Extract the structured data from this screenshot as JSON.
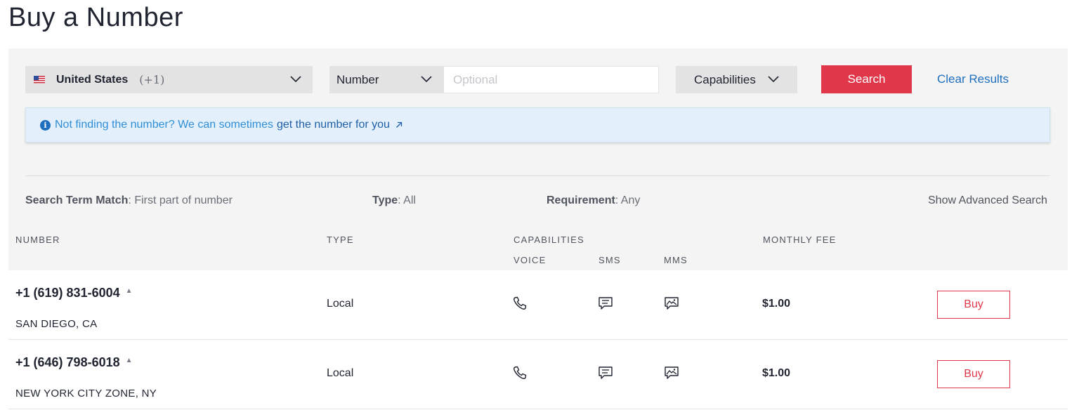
{
  "page": {
    "title": "Buy a Number"
  },
  "search": {
    "country": {
      "name": "United States",
      "code": "(+1)",
      "flag_icon": "us-flag-icon"
    },
    "number_type": {
      "selected": "Number"
    },
    "number_input": {
      "value": "",
      "placeholder": "Optional"
    },
    "capabilities": {
      "label": "Capabilities"
    },
    "search_label": "Search",
    "clear_label": "Clear Results"
  },
  "info_banner": {
    "text": "Not finding the number? We can sometimes",
    "link_text": "get the number for you"
  },
  "filters": {
    "match": {
      "label": "Search Term Match",
      "value": ": First part of number"
    },
    "type": {
      "label": "Type",
      "value": ": All"
    },
    "requirement": {
      "label": "Requirement",
      "value": ": Any"
    },
    "advanced_label": "Show Advanced Search"
  },
  "table": {
    "headers": {
      "number": "NUMBER",
      "type": "TYPE",
      "capabilities": "CAPABILITIES",
      "voice": "VOICE",
      "sms": "SMS",
      "mms": "MMS",
      "monthly_fee": "MONTHLY FEE"
    },
    "rows": [
      {
        "number": "+1 (619) 831-6004",
        "location": "SAN DIEGO, CA",
        "type": "Local",
        "fee": "$1.00",
        "buy_label": "Buy"
      },
      {
        "number": "+1 (646) 798-6018",
        "location": "NEW YORK CITY ZONE, NY",
        "type": "Local",
        "fee": "$1.00",
        "buy_label": "Buy"
      }
    ]
  },
  "colors": {
    "accent_red": "#e0384a",
    "link_blue": "#1f6fbf",
    "banner_bg": "#e3f0fb",
    "panel_bg": "#f4f4f4",
    "select_bg": "#e3e3e3"
  }
}
